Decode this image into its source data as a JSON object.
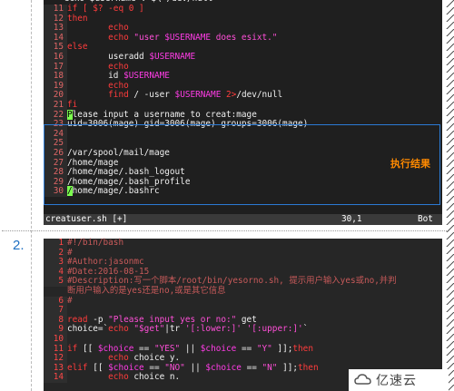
{
  "script1": {
    "top_cut": "    echo $username\": $\\ /dev/null",
    "lines": [
      {
        "n": "11",
        "segments": [
          {
            "c": "kw",
            "t": "if [ $? -eq 0 ]"
          }
        ]
      },
      {
        "n": "12",
        "segments": [
          {
            "c": "kw",
            "t": "then"
          }
        ]
      },
      {
        "n": "13",
        "segments": [
          {
            "c": "kw",
            "t": "        echo"
          }
        ]
      },
      {
        "n": "14",
        "segments": [
          {
            "c": "kw",
            "t": "        echo "
          },
          {
            "c": "str",
            "t": "\"user "
          },
          {
            "c": "var",
            "t": "$USERNAME"
          },
          {
            "c": "str",
            "t": " does esixt.\""
          }
        ]
      },
      {
        "n": "15",
        "segments": [
          {
            "c": "kw",
            "t": "else"
          }
        ]
      },
      {
        "n": "16",
        "segments": [
          {
            "c": "plain",
            "t": "        useradd "
          },
          {
            "c": "var",
            "t": "$USERNAME"
          }
        ]
      },
      {
        "n": "17",
        "segments": [
          {
            "c": "kw",
            "t": "        echo"
          }
        ]
      },
      {
        "n": "18",
        "segments": [
          {
            "c": "plain",
            "t": "        id "
          },
          {
            "c": "var",
            "t": "$USERNAME"
          }
        ]
      },
      {
        "n": "19",
        "segments": [
          {
            "c": "kw",
            "t": "        echo"
          }
        ]
      },
      {
        "n": "20",
        "segments": [
          {
            "c": "plain",
            "t": "        "
          },
          {
            "c": "kw",
            "t": "find"
          },
          {
            "c": "plain",
            "t": " / -user "
          },
          {
            "c": "var",
            "t": "$USERNAME"
          },
          {
            "c": "plain",
            "t": " "
          },
          {
            "c": "kw",
            "t": "2>"
          },
          {
            "c": "plain",
            "t": "/dev/null"
          }
        ]
      },
      {
        "n": "21",
        "segments": [
          {
            "c": "kw",
            "t": "fi"
          }
        ]
      }
    ],
    "output": [
      {
        "n": "22",
        "cursor": "P",
        "text": "lease input a username to creat:mage"
      },
      {
        "n": "23",
        "text": "uid=3006(mage) gid=3006(mage) groups=3006(mage)"
      },
      {
        "n": "24",
        "text": ""
      },
      {
        "n": "25",
        "text": ""
      },
      {
        "n": "26",
        "text": "/var/spool/mail/mage"
      },
      {
        "n": "27",
        "text": "/home/mage"
      },
      {
        "n": "28",
        "text": "/home/mage/.bash_logout"
      },
      {
        "n": "29",
        "text": "/home/mage/.bash_profile"
      },
      {
        "n": "30",
        "cursor": "/",
        "text": "home/mage/.bashrc"
      }
    ],
    "status": {
      "file": "creatuser.sh [+]",
      "pos": "30,1",
      "scroll": "Bot"
    },
    "result_label": "执行结果"
  },
  "item_number": "2.",
  "script2": {
    "lines": [
      {
        "n": "1",
        "segments": [
          {
            "c": "dim",
            "t": "#!/bin/bash"
          }
        ]
      },
      {
        "n": "2",
        "segments": [
          {
            "c": "dim",
            "t": "#"
          }
        ]
      },
      {
        "n": "3",
        "segments": [
          {
            "c": "dim",
            "t": "#Author:jasonmc"
          }
        ]
      },
      {
        "n": "4",
        "segments": [
          {
            "c": "dim",
            "t": "#Date:2016-08-15"
          }
        ]
      },
      {
        "n": "5",
        "segments": [
          {
            "c": "dim",
            "t": "#Description:写一个脚本/root/bin/yesorno.sh, 提示用户输入yes或no,并判"
          }
        ]
      },
      {
        "n": "",
        "segments": [
          {
            "c": "dim",
            "t": "断用户输入的是yes还是no,或是其它信息"
          }
        ]
      },
      {
        "n": "6",
        "segments": [
          {
            "c": "dim",
            "t": "#"
          }
        ]
      },
      {
        "n": "7",
        "segments": [
          {
            "c": "plain",
            "t": ""
          }
        ]
      },
      {
        "n": "8",
        "segments": [
          {
            "c": "kw",
            "t": "read"
          },
          {
            "c": "plain",
            "t": " -p "
          },
          {
            "c": "str",
            "t": "\"Please input yes or no:\""
          },
          {
            "c": "plain",
            "t": " get"
          }
        ]
      },
      {
        "n": "9",
        "segments": [
          {
            "c": "plain",
            "t": "choice=`"
          },
          {
            "c": "kw",
            "t": "echo"
          },
          {
            "c": "plain",
            "t": " "
          },
          {
            "c": "str",
            "t": "\"$get\""
          },
          {
            "c": "plain",
            "t": "|tr "
          },
          {
            "c": "str",
            "t": "'[:lower:]' '[:upper:]'"
          },
          {
            "c": "plain",
            "t": "`"
          }
        ]
      },
      {
        "n": "10",
        "segments": [
          {
            "c": "plain",
            "t": ""
          }
        ]
      },
      {
        "n": "11",
        "segments": [
          {
            "c": "kw",
            "t": "if"
          },
          {
            "c": "plain",
            "t": " [[ "
          },
          {
            "c": "var",
            "t": "$choice"
          },
          {
            "c": "plain",
            "t": " == "
          },
          {
            "c": "str",
            "t": "\"YES\""
          },
          {
            "c": "plain",
            "t": " || "
          },
          {
            "c": "var",
            "t": "$choice"
          },
          {
            "c": "plain",
            "t": " == "
          },
          {
            "c": "str",
            "t": "\"Y\""
          },
          {
            "c": "plain",
            "t": " ]];"
          },
          {
            "c": "kw",
            "t": "then"
          }
        ]
      },
      {
        "n": "12",
        "segments": [
          {
            "c": "kw",
            "t": "        echo"
          },
          {
            "c": "plain",
            "t": " choice y."
          }
        ]
      },
      {
        "n": "13",
        "segments": [
          {
            "c": "kw",
            "t": "elif"
          },
          {
            "c": "plain",
            "t": " [[ "
          },
          {
            "c": "var",
            "t": "$choice"
          },
          {
            "c": "plain",
            "t": " == "
          },
          {
            "c": "str",
            "t": "\"NO\""
          },
          {
            "c": "plain",
            "t": " || "
          },
          {
            "c": "var",
            "t": "$choice"
          },
          {
            "c": "plain",
            "t": " == "
          },
          {
            "c": "str",
            "t": "\"N\""
          },
          {
            "c": "plain",
            "t": " ]];"
          },
          {
            "c": "kw",
            "t": "then"
          }
        ]
      },
      {
        "n": "14",
        "segments": [
          {
            "c": "kw",
            "t": "        echo"
          },
          {
            "c": "plain",
            "t": " choice n."
          }
        ]
      }
    ]
  },
  "watermark": {
    "text": "亿速云",
    "icon": "cloud-logo-icon"
  }
}
